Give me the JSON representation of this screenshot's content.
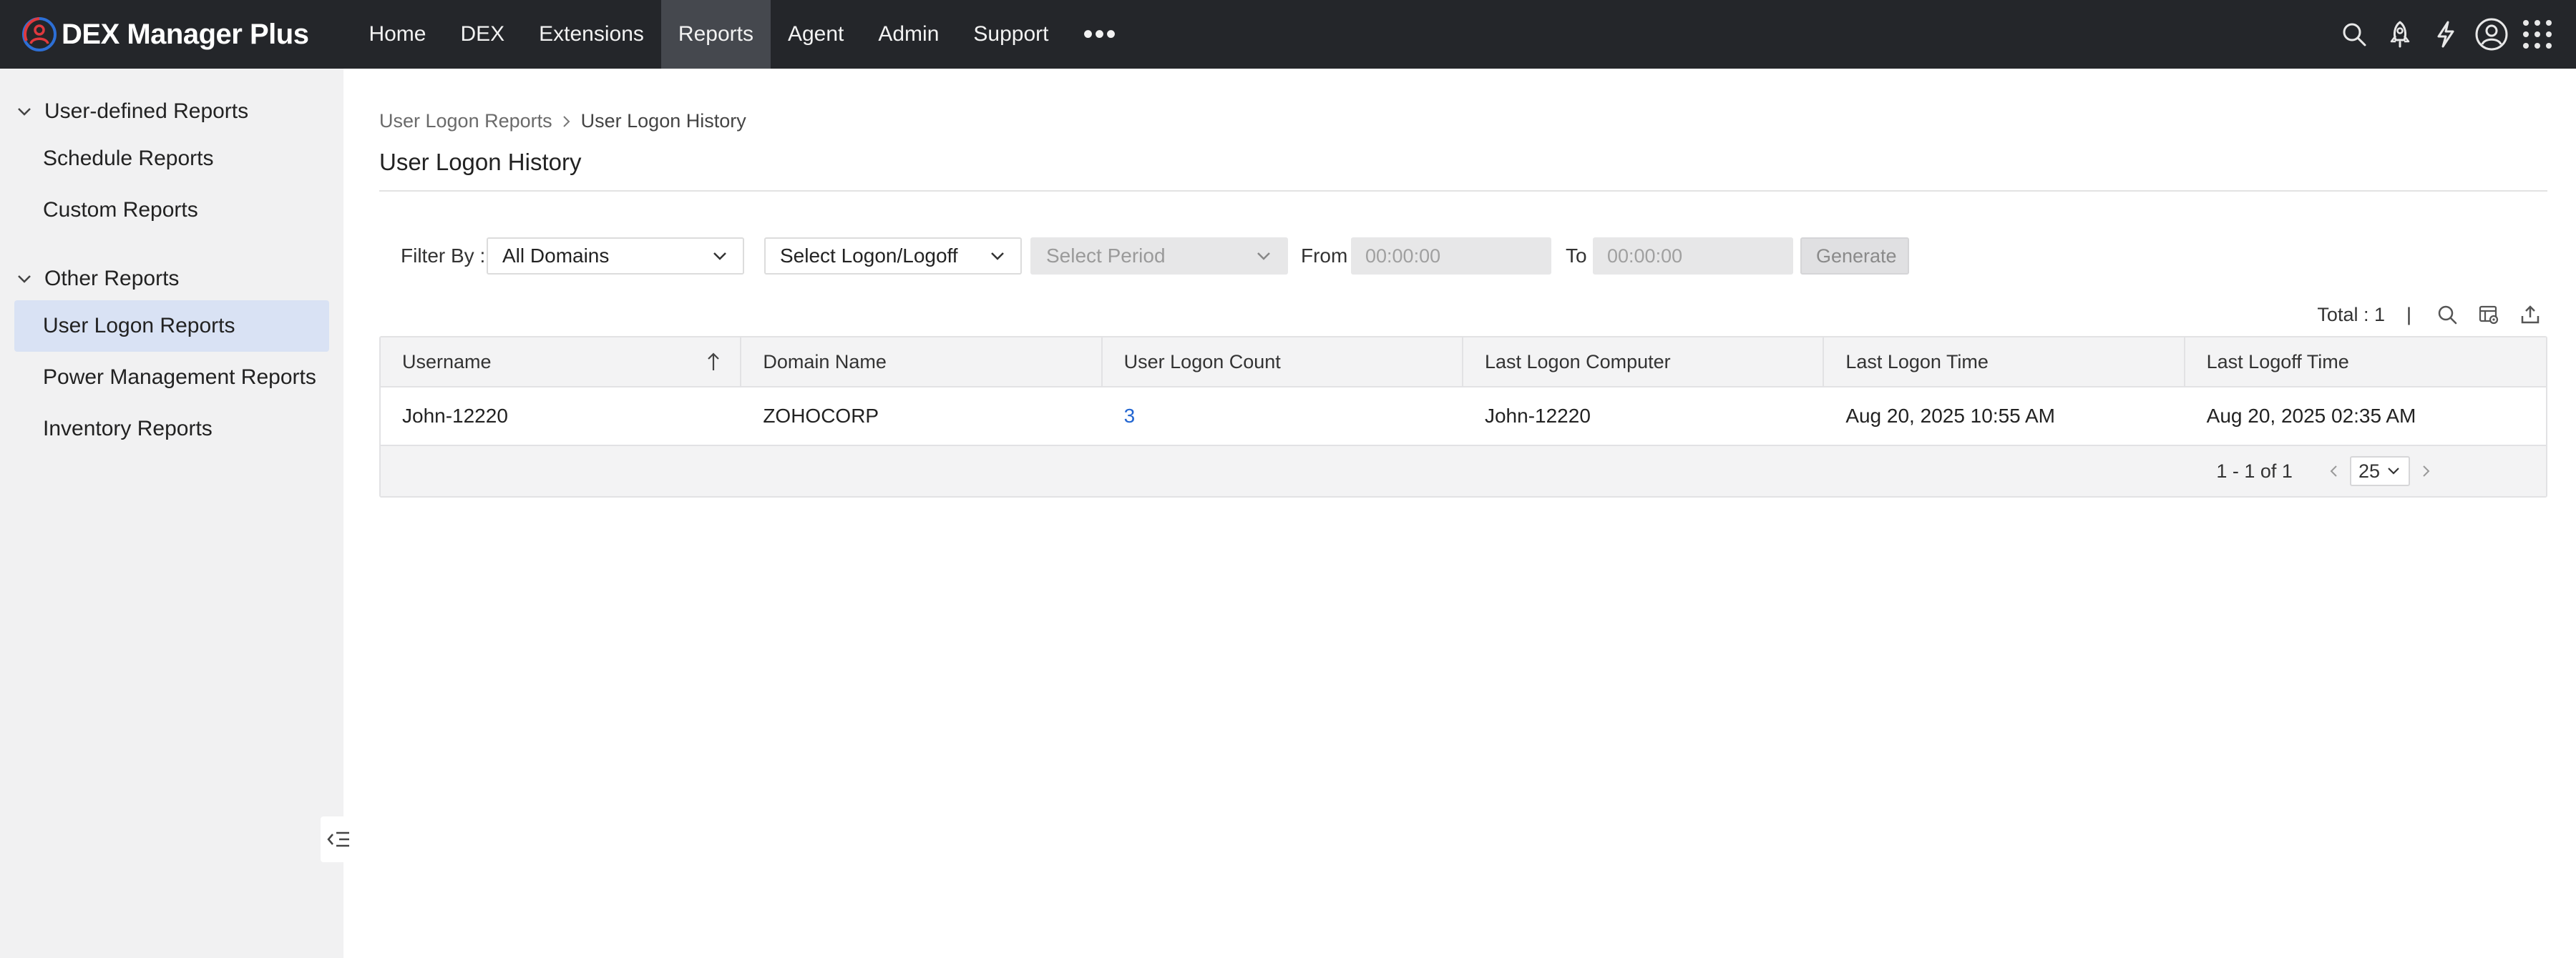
{
  "app": {
    "name": "DEX Manager Plus",
    "nav": [
      {
        "label": "Home",
        "active": false
      },
      {
        "label": "DEX",
        "active": false
      },
      {
        "label": "Extensions",
        "active": false
      },
      {
        "label": "Reports",
        "active": true
      },
      {
        "label": "Agent",
        "active": false
      },
      {
        "label": "Admin",
        "active": false
      },
      {
        "label": "Support",
        "active": false
      }
    ],
    "more_label": "•••",
    "top_icons": [
      "search-icon",
      "rocket-icon",
      "lightning-icon",
      "user-profile-icon",
      "app-grid-icon"
    ]
  },
  "sidebar": {
    "groups": [
      {
        "label": "User-defined Reports",
        "expanded": true,
        "items": [
          {
            "label": "Schedule Reports",
            "active": false
          },
          {
            "label": "Custom Reports",
            "active": false
          }
        ]
      },
      {
        "label": "Other Reports",
        "expanded": true,
        "items": [
          {
            "label": "User Logon Reports",
            "active": true
          },
          {
            "label": "Power Management Reports",
            "active": false
          },
          {
            "label": "Inventory Reports",
            "active": false
          }
        ]
      }
    ]
  },
  "breadcrumb": {
    "parent": "User Logon Reports",
    "current": "User Logon History"
  },
  "page": {
    "title": "User Logon History"
  },
  "filters": {
    "filter_by_label": "Filter By :",
    "domain_value": "All Domains",
    "logon_type_value": "Select Logon/Logoff",
    "period_placeholder": "Select Period",
    "from_label": "From",
    "from_value": "00:00:00",
    "to_label": "To",
    "to_value": "00:00:00",
    "generate_label": "Generate"
  },
  "table": {
    "total_label": "Total : 1",
    "pipe": "|",
    "columns": [
      "Username",
      "Domain Name",
      "User Logon Count",
      "Last Logon Computer",
      "Last Logon Time",
      "Last Logoff Time"
    ],
    "sort_column": "Username",
    "sort_direction": "ascending",
    "rows": [
      [
        "John-12220",
        "ZOHOCORP",
        "3",
        "John-12220",
        "Aug 20, 2025 10:55 AM",
        "Aug 20, 2025 02:35 AM"
      ]
    ],
    "pagination": {
      "range": "1 - 1 of 1",
      "page_size": "25"
    }
  },
  "colors": {
    "topbar_bg": "#24262a",
    "nav_active_bg": "#45484e",
    "sidebar_bg": "#f1f1f2",
    "sidebar_active_bg": "#d9e2f4",
    "link": "#2366d1",
    "brand_icon_red": "#e0393e",
    "brand_icon_blue": "#2d6fd6"
  }
}
